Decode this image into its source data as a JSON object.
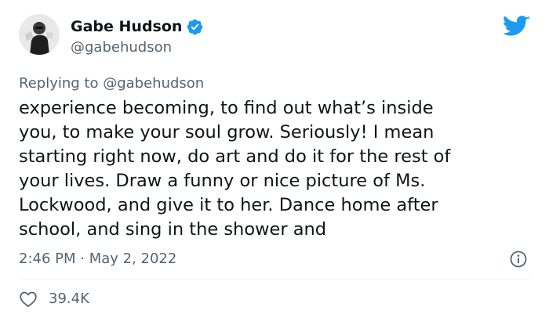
{
  "tweet": {
    "author": {
      "display_name": "Gabe Hudson",
      "handle": "@gabehudson",
      "verified": true
    },
    "reply_prefix": "Replying to",
    "reply_mention": "@gabehudson",
    "text": "experience becoming, to find out what’s inside\nyou, to make your soul grow. Seriously! I mean\nstarting right now, do art and do it for the rest of\nyour lives. Draw a funny or nice picture of Ms.\nLockwood, and give it to her. Dance home after\nschool, and sing in the shower and",
    "timestamp": "2:46 PM · May 2, 2022",
    "likes": "39.4K"
  },
  "icons": {
    "brand": "twitter-bird-icon",
    "verified": "verified-badge-icon",
    "info": "info-icon",
    "like": "heart-icon"
  },
  "colors": {
    "text": "#0f1419",
    "secondary": "#536471",
    "brand_blue": "#1d9bf0",
    "divider": "#eff3f4"
  }
}
